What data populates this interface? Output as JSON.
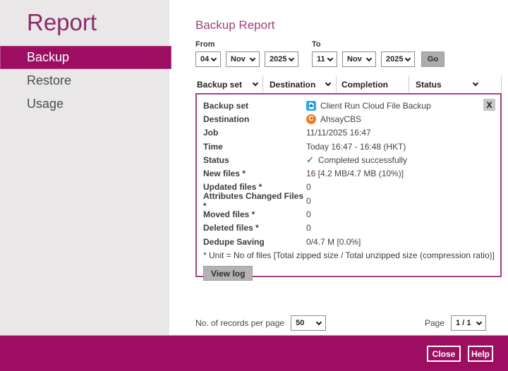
{
  "colors": {
    "brand_magenta": "#9D0E63",
    "sidebar_bg": "#E9E7E8",
    "title_magenta": "#8D2A69",
    "heading_magenta": "#A23E7C",
    "panel_border": "#A24180",
    "success_green": "#3EA34B",
    "cloud_icon_blue": "#2EA7E0",
    "ahsay_icon_orange": "#F07C21",
    "button_gray": "#ACACAC"
  },
  "sidebar": {
    "title": "Report",
    "items": [
      {
        "label": "Backup",
        "selected": true
      },
      {
        "label": "Restore",
        "selected": false
      },
      {
        "label": "Usage",
        "selected": false
      }
    ]
  },
  "main": {
    "heading": "Backup Report",
    "date_filter": {
      "from_label": "From",
      "to_label": "To",
      "from": [
        "04",
        "Nov",
        "2025"
      ],
      "to": [
        "11",
        "Nov",
        "2025"
      ],
      "go_label": "Go"
    },
    "filters": [
      {
        "label": "Backup set"
      },
      {
        "label": "Destination"
      },
      {
        "label": "Completion"
      },
      {
        "label": "Status"
      }
    ],
    "report": {
      "close_label": "X",
      "rows": [
        {
          "label": "Backup set",
          "value": "Client Run Cloud File Backup",
          "icon": "cloud-file-backup-icon"
        },
        {
          "label": "Destination",
          "value": "AhsayCBS",
          "icon": "ahsaycbs-icon"
        },
        {
          "label": "Job",
          "value": "11/11/2025 16:47"
        },
        {
          "label": "Time",
          "value": "Today 16:47 - 16:48 (HKT)"
        },
        {
          "label": "Status",
          "value": "Completed successfully",
          "icon": "check-icon"
        },
        {
          "label": "New files *",
          "value": "16 [4.2 MB/4.7 MB (10%)]"
        },
        {
          "label": "Updated files *",
          "value": "0"
        },
        {
          "label": "Attributes Changed Files *",
          "value": "0"
        },
        {
          "label": "Moved files *",
          "value": "0"
        },
        {
          "label": "Deleted files *",
          "value": "0"
        },
        {
          "label": "Dedupe Saving",
          "value": "0/4.7 M [0.0%]"
        }
      ],
      "footnote": "* Unit = No of files [Total zipped size / Total unzipped size (compression ratio)]",
      "view_log_label": "View log",
      "check_glyph": "✓",
      "ahsay_glyph": "C"
    },
    "pagination": {
      "records_label": "No. of records per page",
      "records_value": "50",
      "page_label": "Page",
      "page_value": "1 / 1"
    }
  },
  "footer": {
    "close_label": "Close",
    "help_label": "Help"
  }
}
